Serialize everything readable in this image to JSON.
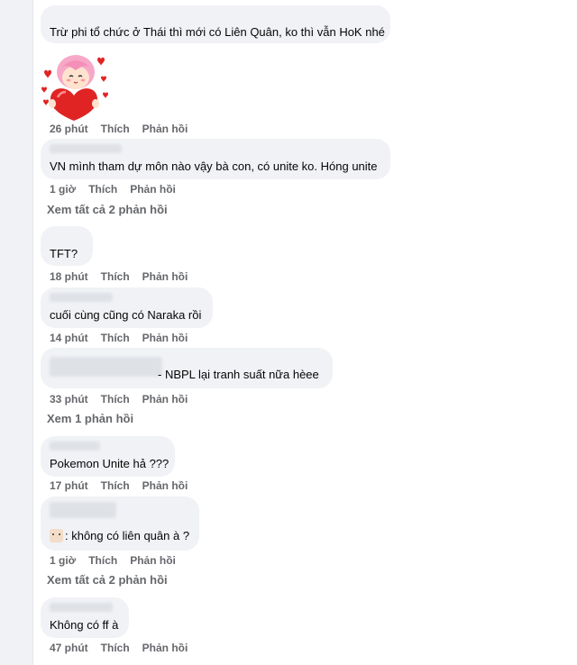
{
  "comments": [
    {
      "text": "Trừ phi tổ chức ở Thái thì mới có Liên Quân, ko thì vẫn HoK nhé"
    },
    {
      "time": "26 phút",
      "like": "Thích",
      "reply": "Phản hồi"
    },
    {
      "text": "VN mình tham dự môn nào vậy bà con, có unite ko. Hóng unite",
      "time": "1 giờ",
      "like": "Thích",
      "reply": "Phản hồi",
      "view_replies": "Xem tất cả 2 phản hồi"
    },
    {
      "text": "TFT?",
      "time": "18 phút",
      "like": "Thích",
      "reply": "Phản hồi"
    },
    {
      "text": "cuối cùng cũng có Naraka rồi",
      "time": "14 phút",
      "like": "Thích",
      "reply": "Phản hồi"
    },
    {
      "text": "- NBPL lại tranh suất nữa hèee",
      "time": "33 phút",
      "like": "Thích",
      "reply": "Phản hồi",
      "view_replies": "Xem 1 phản hồi"
    },
    {
      "text": "Pokemon Unite hả ???",
      "time": "17 phút",
      "like": "Thích",
      "reply": "Phản hồi"
    },
    {
      "text": ": không có liên quân à ?",
      "time": "1 giờ",
      "like": "Thích",
      "reply": "Phản hồi",
      "view_replies": "Xem tất cả 2 phản hồi"
    },
    {
      "text": "Không có ff à",
      "time": "47 phút",
      "like": "Thích",
      "reply": "Phản hồi"
    }
  ],
  "icons": {
    "sticker": "girl-holding-heart-sticker",
    "emoji": "dog-face-emoji"
  },
  "colors": {
    "bubble": "#f0f2f5",
    "meta_text": "#65676b",
    "heart": "#e02424"
  }
}
